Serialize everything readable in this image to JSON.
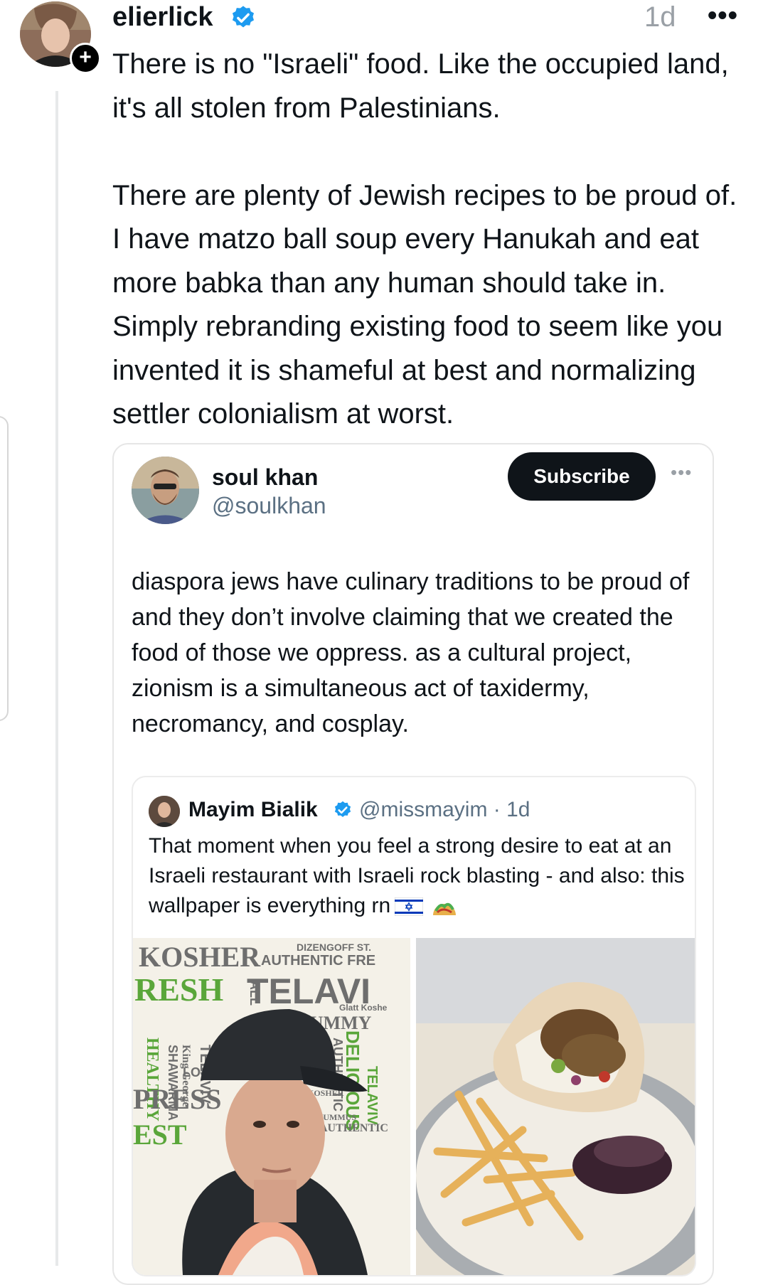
{
  "post": {
    "username": "elierlick",
    "time": "1d",
    "more": "•••",
    "add_symbol": "+",
    "paragraphs": [
      "There is no \"Israeli\" food. Like the occupied land, it's all stolen from Palestinians.",
      "There are plenty of Jewish recipes to be proud of. I have matzo ball soup every Hanukah and eat more babka than any human should take in. Simply rebranding existing food to seem like you invented it is shameful at best and normalizing settler colonialism at worst."
    ]
  },
  "quoted": {
    "name": "soul khan",
    "handle": "@soulkhan",
    "subscribe_label": "Subscribe",
    "more": "•••",
    "text": "diaspora jews have culinary traditions to be proud of and they don’t involve claiming that we created the food of those we oppress. as a cultural project, zionism is a simultaneous act of taxidermy, necromancy, and cosplay."
  },
  "nested": {
    "name": "Mayim Bialik",
    "handle_time": "@missmayim · 1d",
    "text": "That moment when you feel a strong desire to eat at an Israeli restaurant with Israeli rock blasting - and also: this wallpaper is everything rn",
    "wallpaper_words": [
      "KOSHER",
      "AUTHENTIC FRE",
      "DIZENGOFF ST.",
      "RESH",
      "TELAVI",
      "Glatt Koshe",
      "YUMMY",
      "HEALTHY",
      "SHAWARMA",
      "King George",
      "TELAVIV",
      "AUTHENTIC",
      "DELICIOUS",
      "TELAVIV",
      "PRESS",
      "KOSHER",
      "HUMMUS",
      "AUTHENTIC",
      "LOS",
      "ALL",
      "EST"
    ]
  },
  "colors": {
    "verified": "#1d9bf0",
    "muted": "#5b7083",
    "button_bg": "#0f1419",
    "wallpaper_green": "#5aa63a",
    "wallpaper_gray": "#6e6e6e"
  },
  "icons": [
    "add-icon",
    "verified-badge-icon",
    "more-icon",
    "israel-flag-emoji",
    "taco-emoji"
  ]
}
